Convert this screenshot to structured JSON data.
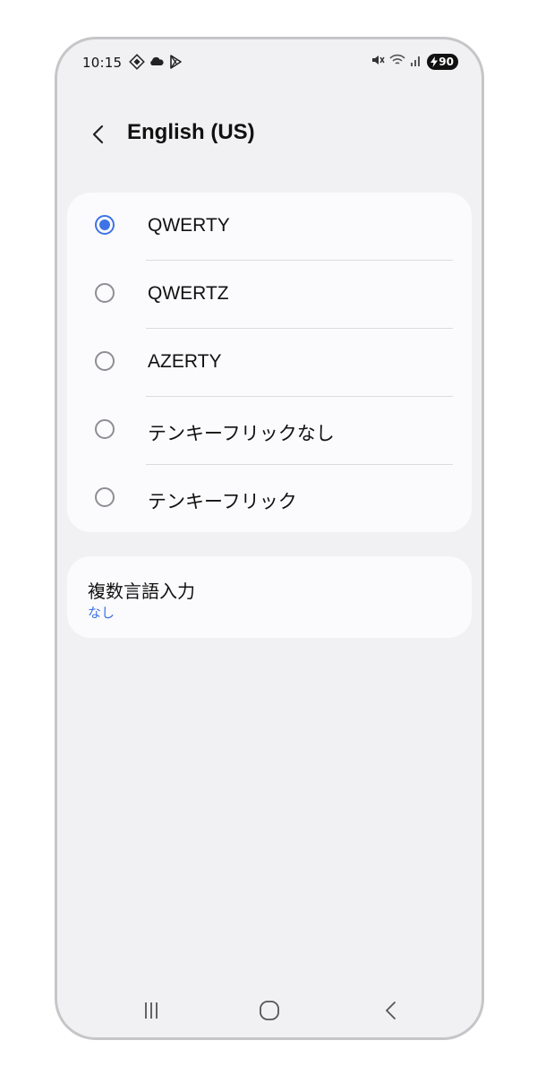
{
  "status_bar": {
    "time": "10:15",
    "battery_level": "90",
    "left_icons": [
      "vpn-key-icon",
      "cloud-icon",
      "play-store-icon"
    ],
    "right_icons": [
      "mute-icon",
      "wifi-icon",
      "signal-icon",
      "battery-charging-icon"
    ]
  },
  "header": {
    "back_icon": "chevron-left-icon",
    "title": "English (US)"
  },
  "keyboard_layouts": {
    "selected_index": 0,
    "options": [
      {
        "label": "QWERTY",
        "selected": true
      },
      {
        "label": "QWERTZ",
        "selected": false
      },
      {
        "label": "AZERTY",
        "selected": false
      },
      {
        "label": "テンキーフリックなし",
        "selected": false
      },
      {
        "label": "テンキーフリック",
        "selected": false
      }
    ]
  },
  "multi_input": {
    "title": "複数言語入力",
    "value": "なし"
  },
  "nav_bar": {
    "icons": [
      "recent-apps-icon",
      "home-icon",
      "back-icon"
    ]
  },
  "colors": {
    "accent": "#3d73e6",
    "background": "#f1f1f3",
    "card": "#fbfbfd",
    "text": "#111111"
  }
}
